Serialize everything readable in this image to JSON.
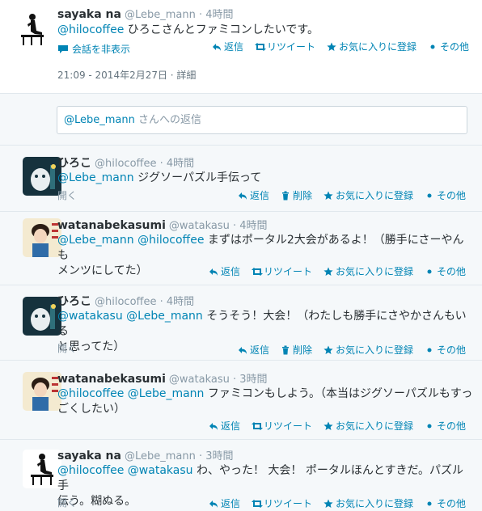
{
  "main_tweet": {
    "fullname": "sayaka na",
    "screen_name": "@Lebe_mann",
    "time": "4時間",
    "mention": "@hilocoffee",
    "text": " ひろこさんとファミコンしたいです。",
    "hide_conversation": "会話を非表示",
    "timestamp": "21:09 - 2014年2月27日 · 詳細",
    "actions": {
      "reply": "返信",
      "retweet": "リツイート",
      "favorite": "お気に入りに登録",
      "more": "その他"
    }
  },
  "reply_box": {
    "mention": "@Lebe_mann",
    "placeholder": " さんへの返信"
  },
  "replies": [
    {
      "fullname": "ひろこ",
      "screen_name": "@hilocoffee",
      "time": "4時間",
      "mentions": "@Lebe_mann",
      "text": " ジグソーパズル手伝って",
      "text2": "",
      "open": "開く",
      "actions": {
        "reply": "返信",
        "delete": "削除",
        "favorite": "お気に入りに登録",
        "more": "その他"
      }
    },
    {
      "fullname": "watanabekasumi",
      "screen_name": "@watakasu",
      "time": "4時間",
      "mentions": "@Lebe_mann @hilocoffee",
      "text": " まずはポータル2大会があるよ！（勝手にさーやんも",
      "text2": "メンツにしてた）",
      "open": "",
      "actions": {
        "reply": "返信",
        "retweet": "リツイート",
        "favorite": "お気に入りに登録",
        "more": "その他"
      }
    },
    {
      "fullname": "ひろこ",
      "screen_name": "@hilocoffee",
      "time": "4時間",
      "mentions": "@watakasu @Lebe_mann",
      "text": " そうそう！大会！（わたしも勝手にさやかさんもいる",
      "text2": "と思ってた）",
      "open": "開く",
      "actions": {
        "reply": "返信",
        "delete": "削除",
        "favorite": "お気に入りに登録",
        "more": "その他"
      }
    },
    {
      "fullname": "watanabekasumi",
      "screen_name": "@watakasu",
      "time": "3時間",
      "mentions": "@hilocoffee @Lebe_mann",
      "text": " ファミコンもしよう。（本当はジグソーパズルもすっ",
      "text2": "ごくしたい）",
      "open": "",
      "actions": {
        "reply": "返信",
        "retweet": "リツイート",
        "favorite": "お気に入りに登録",
        "more": "その他"
      }
    },
    {
      "fullname": "sayaka na",
      "screen_name": "@Lebe_mann",
      "time": "3時間",
      "mentions": "@hilocoffee @watakasu",
      "text": " わ、やった！ 大会！ ポータルほんとすきだ。パズル手",
      "text2": "伝う。糊ぬる。",
      "open": "開く",
      "actions": {
        "reply": "返信",
        "retweet": "リツイート",
        "favorite": "お気に入りに登録",
        "more": "その他"
      }
    }
  ],
  "colors": {
    "link": "#0084b4",
    "muted": "#8899a6",
    "text": "#292f33",
    "divider": "#e1e8ed"
  }
}
